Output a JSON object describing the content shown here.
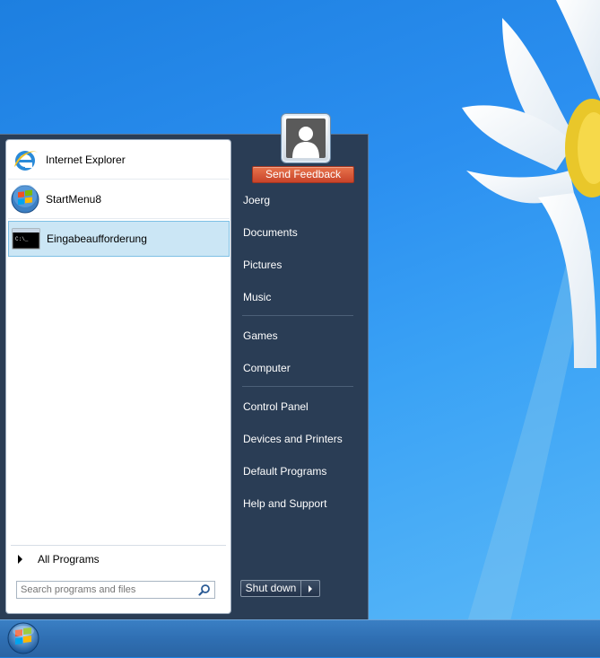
{
  "start_menu": {
    "pinned_programs": [
      {
        "label": "Internet Explorer",
        "icon": "internet-explorer-icon"
      },
      {
        "label": "StartMenu8",
        "icon": "startmenu8-icon"
      },
      {
        "label": "Eingabeaufforderung",
        "icon": "command-prompt-icon",
        "selected": true
      }
    ],
    "all_programs_label": "All Programs",
    "search": {
      "placeholder": "Search programs and files",
      "icon": "search-icon"
    },
    "user": {
      "avatar_icon": "user-avatar-icon",
      "feedback_label": "Send Feedback"
    },
    "right_items": [
      {
        "label": "Joerg"
      },
      {
        "label": "Documents"
      },
      {
        "label": "Pictures"
      },
      {
        "label": "Music"
      },
      {
        "label": "Games"
      },
      {
        "label": "Computer"
      },
      {
        "label": "Control Panel"
      },
      {
        "label": "Devices and Printers"
      },
      {
        "label": "Default Programs"
      },
      {
        "label": "Help and Support"
      }
    ],
    "shutdown_label": "Shut down",
    "cmd_icon_text": "C:\\_"
  },
  "taskbar": {
    "start_icon": "windows-start-orb-icon"
  },
  "colors": {
    "right_pane": "#2a3d55",
    "feedback_button": "#d9573a",
    "selection": "#cbe6f5",
    "desktop": "#2b8ff0"
  }
}
